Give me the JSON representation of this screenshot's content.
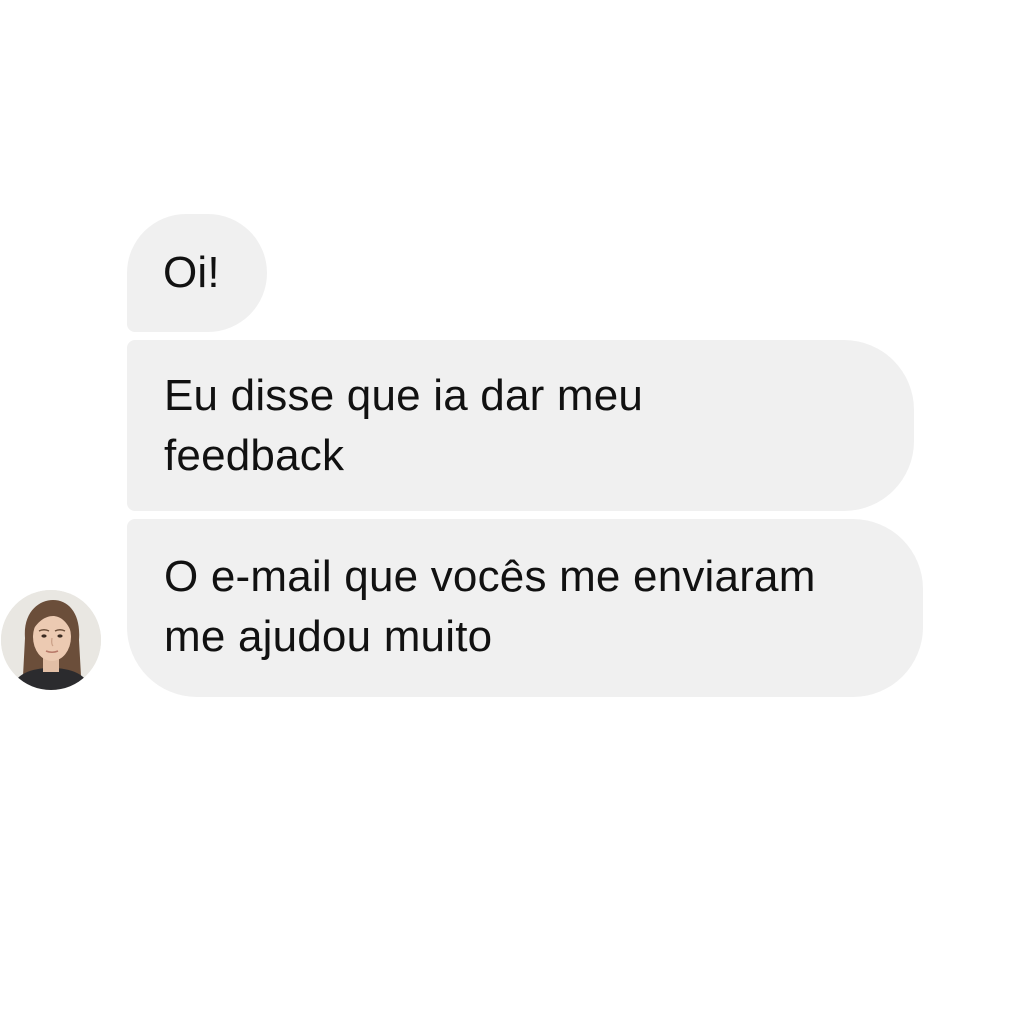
{
  "conversation": {
    "contact": {
      "avatar_icon": "person-photo"
    },
    "messages": [
      {
        "text": "Oi!"
      },
      {
        "text": "Eu disse que ia dar meu\nfeedback"
      },
      {
        "text": "O e-mail que vocês me enviaram\nme ajudou muito"
      }
    ]
  },
  "colors": {
    "bubble": "#f0f0f0",
    "text": "#111111",
    "background": "#ffffff"
  }
}
